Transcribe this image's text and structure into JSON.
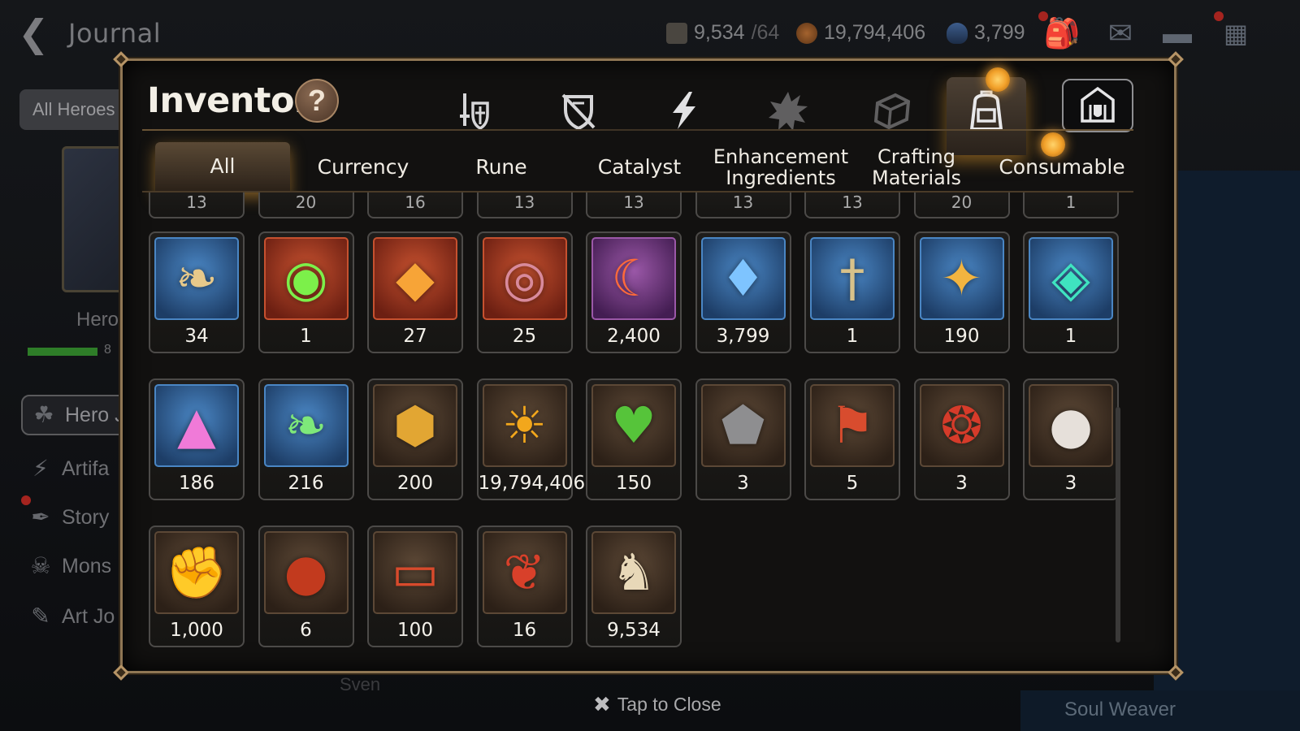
{
  "topbar": {
    "title": "Journal",
    "stamina": "9,534",
    "stamina_max": "/64",
    "gold": "19,794,406",
    "skystone": "3,799"
  },
  "sidebar": {
    "all_heroes": "All Heroes",
    "hero_label": "Hero",
    "hero_progress_text": "8",
    "items": [
      {
        "label": "Hero J"
      },
      {
        "label": "Artifa"
      },
      {
        "label": "Story"
      },
      {
        "label": "Mons"
      },
      {
        "label": "Art Jo"
      }
    ]
  },
  "background": {
    "sven": "Sven",
    "soul_weaver": "Soul Weaver"
  },
  "modal": {
    "title": "Inventory",
    "help": "?",
    "category_tabs": [
      {
        "icon": "weapon-armor-icon"
      },
      {
        "icon": "artifact-icon"
      },
      {
        "icon": "lightning-icon"
      },
      {
        "icon": "catalyst-burst-icon"
      },
      {
        "icon": "box-icon"
      },
      {
        "icon": "backpack-icon",
        "selected": true
      },
      {
        "icon": "shop-icon"
      }
    ],
    "sub_tabs": [
      {
        "label": "All",
        "selected": true
      },
      {
        "label": "Currency"
      },
      {
        "label": "Rune"
      },
      {
        "label": "Catalyst"
      },
      {
        "label": "Enhancement\nIngredients"
      },
      {
        "label": "Crafting\nMaterials"
      },
      {
        "label": "Consumable"
      }
    ],
    "items": [
      {
        "name": "root-herb-icon",
        "qty": "34",
        "frame": "blue"
      },
      {
        "name": "green-gem-icon",
        "qty": "1",
        "frame": "red"
      },
      {
        "name": "flame-crystal-icon",
        "qty": "27",
        "frame": "red"
      },
      {
        "name": "rune-disc-icon",
        "qty": "25",
        "frame": "red"
      },
      {
        "name": "crescent-flower-icon",
        "qty": "2,400",
        "frame": "purple"
      },
      {
        "name": "skystone-icon",
        "qty": "3,799",
        "frame": "blue"
      },
      {
        "name": "dagger-charm-icon",
        "qty": "1",
        "frame": "blue"
      },
      {
        "name": "star-amulet-icon",
        "qty": "190",
        "frame": "blue"
      },
      {
        "name": "teal-crystal-icon",
        "qty": "1",
        "frame": "blue"
      },
      {
        "name": "pink-mountain-icon",
        "qty": "186",
        "frame": "blue"
      },
      {
        "name": "green-leaf-icon",
        "qty": "216",
        "frame": "blue"
      },
      {
        "name": "gold-hexagon-icon",
        "qty": "200",
        "frame": "brown"
      },
      {
        "name": "gold-coin-icon",
        "qty": "19,794,406",
        "frame": "brown"
      },
      {
        "name": "green-heart-icon",
        "qty": "150",
        "frame": "brown"
      },
      {
        "name": "stone-compass-icon",
        "qty": "3",
        "frame": "brown"
      },
      {
        "name": "red-banner-icon",
        "qty": "5",
        "frame": "brown"
      },
      {
        "name": "red-seal-icon",
        "qty": "3",
        "frame": "brown"
      },
      {
        "name": "robot-pet-icon",
        "qty": "3",
        "frame": "brown"
      },
      {
        "name": "fist-emblem-icon",
        "qty": "1,000",
        "frame": "brown"
      },
      {
        "name": "dark-orb-icon",
        "qty": "6",
        "frame": "brown"
      },
      {
        "name": "red-ring-icon",
        "qty": "100",
        "frame": "brown"
      },
      {
        "name": "red-leaf-icon",
        "qty": "16",
        "frame": "brown"
      },
      {
        "name": "chess-knight-icon",
        "qty": "9,534",
        "frame": "brown"
      }
    ],
    "cut_row_qty": [
      "13",
      "20",
      "16",
      "13",
      "13",
      "13",
      "13",
      "20",
      "1"
    ]
  },
  "footer": {
    "tap_to_close": "Tap to Close"
  },
  "colors": {
    "accent_gold": "#d8a04a",
    "frame_border": "#8f7654",
    "frame_blue": "#3d6fa6",
    "frame_red": "#b9432c",
    "frame_purple": "#8b4a9d",
    "frame_brown": "#5a4634"
  }
}
